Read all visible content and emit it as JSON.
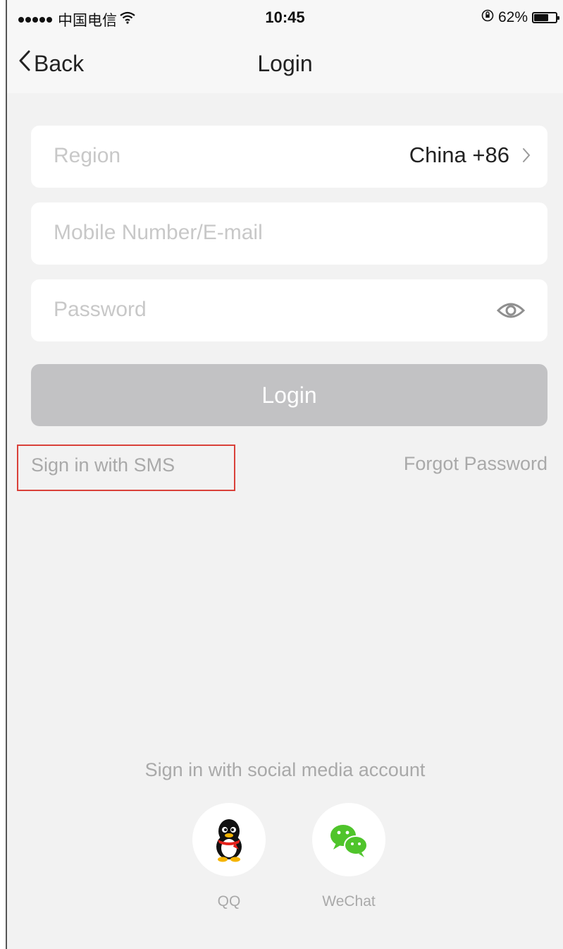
{
  "status_bar": {
    "carrier": "中国电信",
    "time": "10:45",
    "battery": "62%",
    "battery_level": 0.62
  },
  "nav": {
    "back_label": "Back",
    "title": "Login"
  },
  "form": {
    "region_label": "Region",
    "region_value": "China +86",
    "mobile_placeholder": "Mobile Number/E-mail",
    "password_placeholder": "Password",
    "login_label": "Login"
  },
  "links": {
    "sms": "Sign in with SMS",
    "forgot": "Forgot Password"
  },
  "social": {
    "title": "Sign in with social media account",
    "qq_label": "QQ",
    "wechat_label": "WeChat"
  },
  "colors": {
    "background": "#f2f2f2",
    "login_disabled": "#c2c2c4",
    "highlight_box": "#d9413a",
    "wechat_green": "#4fc42b"
  }
}
